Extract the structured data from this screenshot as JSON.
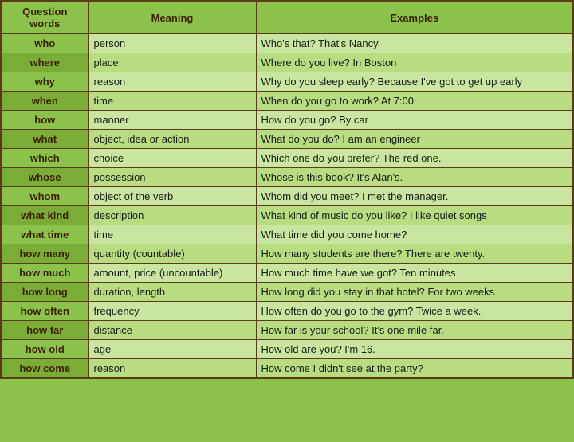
{
  "table": {
    "headers": [
      "Question words",
      "Meaning",
      "Examples"
    ],
    "rows": [
      {
        "word": "who",
        "meaning": "person",
        "example": "Who's that? That's Nancy."
      },
      {
        "word": "where",
        "meaning": "place",
        "example": "Where do you live? In Boston"
      },
      {
        "word": "why",
        "meaning": "reason",
        "example": "Why do you sleep early? Because I've got to get up early"
      },
      {
        "word": "when",
        "meaning": "time",
        "example": "When do you go to work? At 7:00"
      },
      {
        "word": "how",
        "meaning": "manner",
        "example": "How do you go? By car"
      },
      {
        "word": "what",
        "meaning": "object, idea or action",
        "example": "What do you do? I am an engineer"
      },
      {
        "word": "which",
        "meaning": "choice",
        "example": "Which one do you prefer? The red one."
      },
      {
        "word": "whose",
        "meaning": "possession",
        "example": "Whose is this book? It's Alan's."
      },
      {
        "word": "whom",
        "meaning": "object of the verb",
        "example": "Whom did you meet? I met the manager."
      },
      {
        "word": "what kind",
        "meaning": "description",
        "example": "What kind of music do you like? I like quiet songs"
      },
      {
        "word": "what time",
        "meaning": "time",
        "example": "What time did you come home?"
      },
      {
        "word": "how many",
        "meaning": "quantity (countable)",
        "example": "How many students are there? There are twenty."
      },
      {
        "word": "how much",
        "meaning": "amount, price (uncountable)",
        "example": "How much time have we got? Ten minutes"
      },
      {
        "word": "how long",
        "meaning": "duration, length",
        "example": "How long did you stay in that hotel? For two weeks."
      },
      {
        "word": "how often",
        "meaning": "frequency",
        "example": "How often do you go to the gym? Twice a week."
      },
      {
        "word": "how far",
        "meaning": "distance",
        "example": "How far is your school? It's one mile far."
      },
      {
        "word": "how old",
        "meaning": "age",
        "example": "How old are you? I'm 16."
      },
      {
        "word": "how come",
        "meaning": "reason",
        "example": "How come I didn't see at the party?"
      }
    ]
  }
}
